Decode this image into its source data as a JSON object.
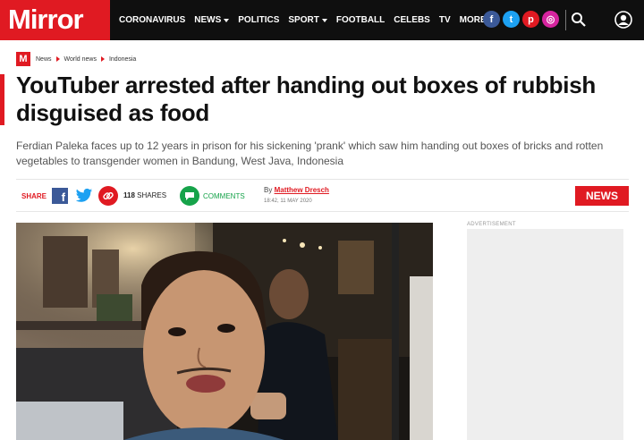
{
  "brand": {
    "logo_text": "Mirror",
    "mini_logo": "M",
    "accent": "#e01a22"
  },
  "nav": {
    "items": [
      {
        "label": "CORONAVIRUS",
        "dropdown": false
      },
      {
        "label": "NEWS",
        "dropdown": true
      },
      {
        "label": "POLITICS",
        "dropdown": false
      },
      {
        "label": "SPORT",
        "dropdown": true
      },
      {
        "label": "FOOTBALL",
        "dropdown": false
      },
      {
        "label": "CELEBS",
        "dropdown": false
      },
      {
        "label": "TV",
        "dropdown": false
      },
      {
        "label": "MORE",
        "dropdown": true
      }
    ],
    "socials": [
      {
        "name": "facebook-icon",
        "glyph": "f",
        "color": "#3b5998"
      },
      {
        "name": "twitter-icon",
        "glyph": "t",
        "color": "#1da1f2"
      },
      {
        "name": "pinterest-icon",
        "glyph": "p",
        "color": "#e01a22"
      },
      {
        "name": "instagram-icon",
        "glyph": "◎",
        "color": "#d6249f"
      }
    ]
  },
  "breadcrumb": [
    "News",
    "World news",
    "Indonesia"
  ],
  "article": {
    "headline": "YouTuber arrested after handing out boxes of rubbish disguised as food",
    "standfirst": "Ferdian Paleka faces up to 12 years in prison for his sickening 'prank' which saw him handing out boxes of bricks and rotten vegetables to transgender women in Bandung, West Java, Indonesia"
  },
  "share": {
    "label": "SHARE",
    "count": "118",
    "count_suffix": "SHARES",
    "comments_label": "COMMENTS"
  },
  "byline": {
    "prefix": "By",
    "author": "Matthew Dresch",
    "date": "18:42, 11 MAY 2020"
  },
  "section_badge": "NEWS",
  "ad": {
    "label": "ADVERTISEMENT"
  }
}
